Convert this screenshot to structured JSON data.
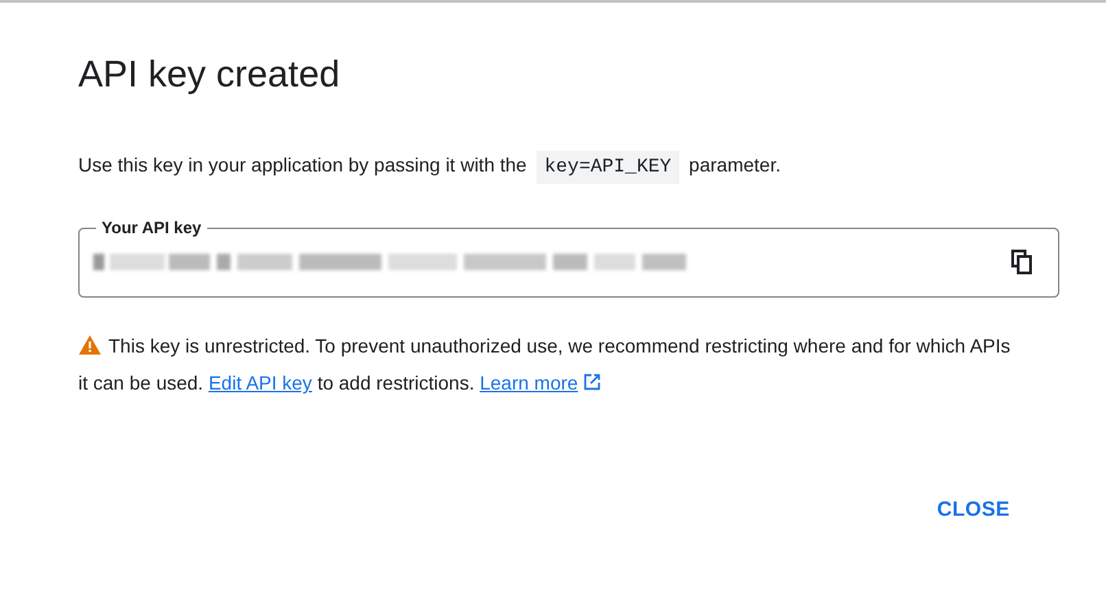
{
  "dialog": {
    "title": "API key created",
    "instruction": {
      "before": "Use this key in your application by passing it with the",
      "code": "key=API_KEY",
      "after": "parameter."
    },
    "key_field": {
      "label": "Your API key"
    },
    "warning": {
      "before": "This key is unrestricted. To prevent unauthorized use, we recommend restricting where and for which APIs it can be used.",
      "edit_link": "Edit API key",
      "middle": "to add restrictions.",
      "learn_link": "Learn more"
    },
    "buttons": [
      "CLOSE"
    ]
  }
}
